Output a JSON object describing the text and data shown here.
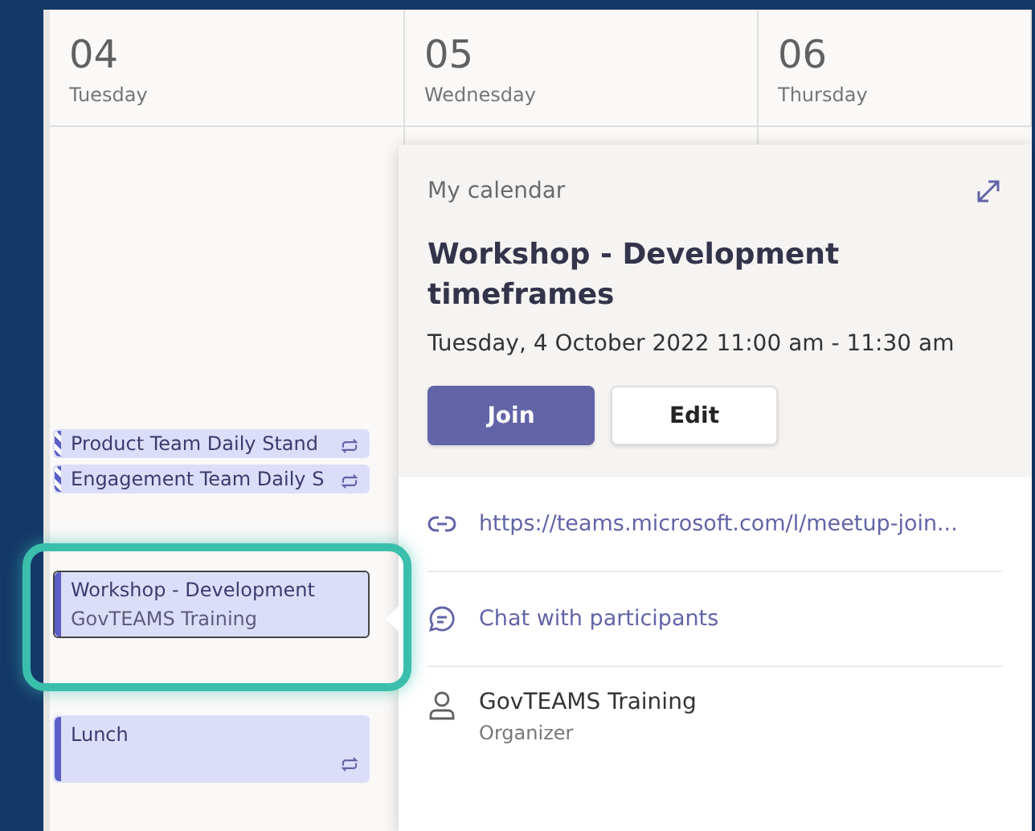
{
  "days": [
    {
      "number": "04",
      "weekday": "Tuesday"
    },
    {
      "number": "05",
      "weekday": "Wednesday"
    },
    {
      "number": "06",
      "weekday": "Thursday"
    }
  ],
  "events": [
    {
      "title": "Product Team Daily Stand",
      "tentative": true,
      "recurring": true,
      "selected": false
    },
    {
      "title": "Engagement Team Daily S",
      "tentative": true,
      "recurring": true,
      "selected": false
    },
    {
      "title": "Workshop - Development",
      "subtitle": "GovTEAMS Training",
      "tentative": false,
      "recurring": false,
      "selected": true
    },
    {
      "title": "Lunch",
      "tentative": false,
      "recurring": true,
      "selected": false
    }
  ],
  "popup": {
    "calendar": "My calendar",
    "title": "Workshop - Development timeframes",
    "when": "Tuesday, 4 October 2022 11:00 am - 11:30 am",
    "join": "Join",
    "edit": "Edit",
    "rows": [
      {
        "kind": "link",
        "text": "https://teams.microsoft.com/l/meetup-join..."
      },
      {
        "kind": "chat",
        "text": "Chat with participants"
      },
      {
        "kind": "person",
        "text": "GovTEAMS Training",
        "subtext": "Organizer"
      }
    ]
  }
}
